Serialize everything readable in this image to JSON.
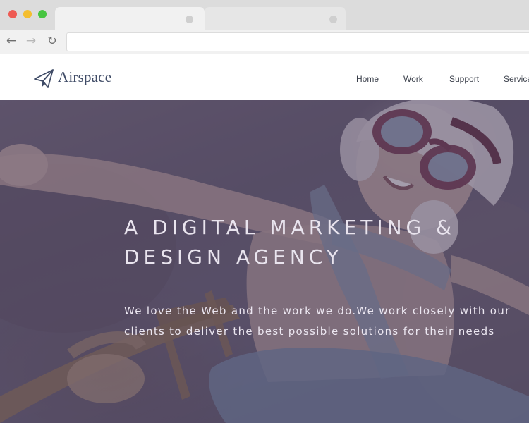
{
  "browser": {
    "url": "",
    "nav": {
      "back_icon": "arrow-left-icon",
      "forward_icon": "arrow-right-icon",
      "reload_icon": "reload-icon"
    },
    "window_controls": {
      "close": "#ee5b54",
      "minimize": "#f4be2f",
      "maximize": "#47c541"
    }
  },
  "site": {
    "logo_text": "Airspace",
    "logo_icon": "paper-plane-icon",
    "brand_color": "#3f4b66",
    "menu": [
      {
        "label": "Home"
      },
      {
        "label": "Work"
      },
      {
        "label": "Support"
      },
      {
        "label": "Service"
      }
    ]
  },
  "hero": {
    "title_line1": "A DIGITAL MARKETING &",
    "title_line2": "DESIGN AGENCY",
    "subtitle_line1": "We love the Web and the work we do.We work closely with our",
    "subtitle_line2": "clients to deliver the best possible solutions for their needs",
    "overlay_color": "#4e4868"
  }
}
